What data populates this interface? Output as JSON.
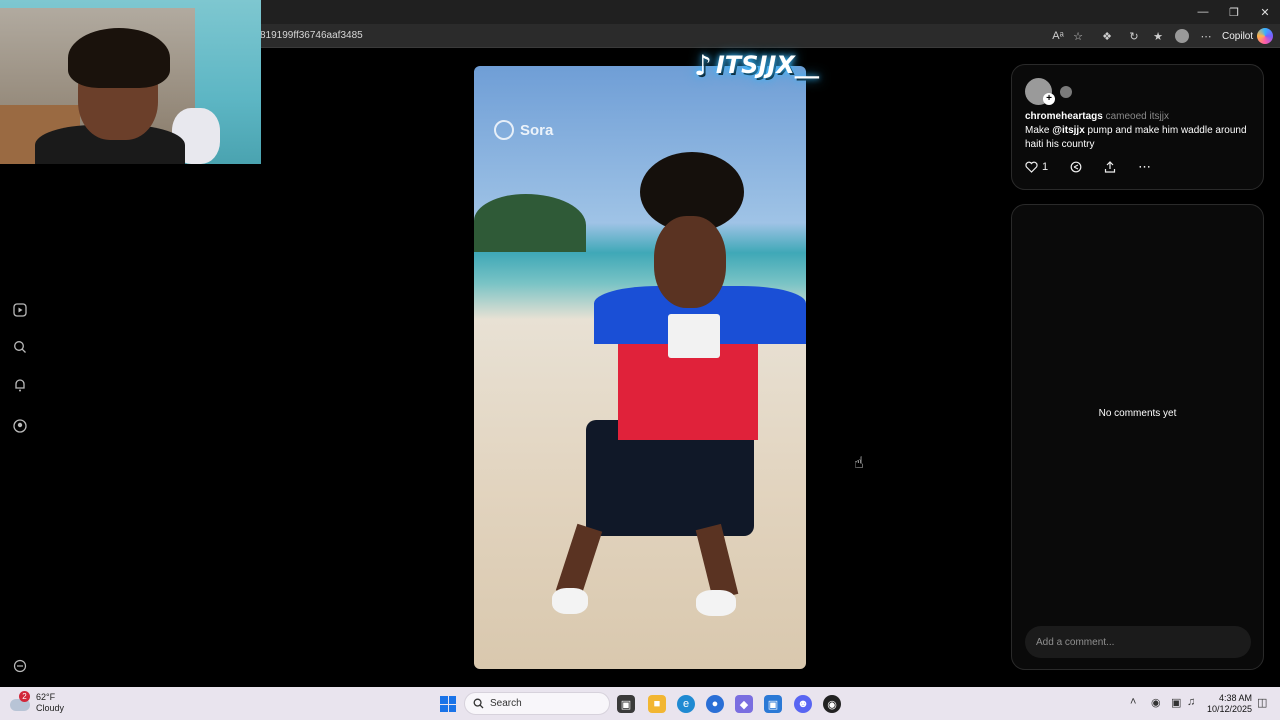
{
  "browser": {
    "url": "819199ff36746aaf3485",
    "copilot_label": "Copilot",
    "read_aloud": "Aᵃ"
  },
  "overlay": {
    "tiktok_handle": "ITSJJX__"
  },
  "video": {
    "brand": "Sora"
  },
  "post": {
    "username": "chromeheartags",
    "action_text": "cameoed itsjjx",
    "caption_pre": "Make ",
    "caption_mention": "@itsjjx",
    "caption_post": " pump and make him waddle around haiti his country",
    "like_count": "1"
  },
  "comments": {
    "empty_text": "No comments yet",
    "input_placeholder": "Add a comment..."
  },
  "taskbar": {
    "weather_temp": "62°F",
    "weather_desc": "Cloudy",
    "weather_badge": "2",
    "search_label": "Search",
    "time": "4:38 AM",
    "date": "10/12/2025"
  },
  "icons": [
    "play-icon",
    "search-icon",
    "bell-icon",
    "profile-icon",
    "minus-circle-icon",
    "heart-icon",
    "remix-icon",
    "share-icon",
    "more-icon"
  ]
}
